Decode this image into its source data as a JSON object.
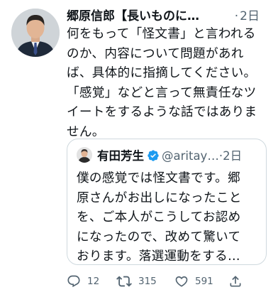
{
  "tweet": {
    "author_name": "郷原信郎【長いものに…",
    "time_separator": "·",
    "time": "2日",
    "text_lines": [
      "何をもって「怪文書」と言われる",
      "のか、内容について問題があれ",
      "ば、具体的に指摘してください。",
      "「感覚」などと言って無責任なツ",
      "イートをするような話ではありま",
      "せん。"
    ]
  },
  "quoted_tweet": {
    "author_name": "有田芳生",
    "handle": "@aritay…",
    "time_separator": "·",
    "time": "2日",
    "text_lines": [
      "僕の感覚では怪文書です。郷",
      "原さんがお出しになったこと",
      "を、ご本人がこうしてお認め",
      "になったので、改めて驚いて",
      "おります。落選運動をする…"
    ]
  },
  "actions": {
    "reply_count": "12",
    "retweet_count": "315",
    "like_count": "591"
  },
  "colors": {
    "text": "#0f1419",
    "secondary": "#536471",
    "verified": "#1d9bf0",
    "border": "#cfd9de"
  },
  "icons": [
    "reply-icon",
    "retweet-icon",
    "like-icon",
    "share-icon",
    "verified-badge-icon"
  ]
}
